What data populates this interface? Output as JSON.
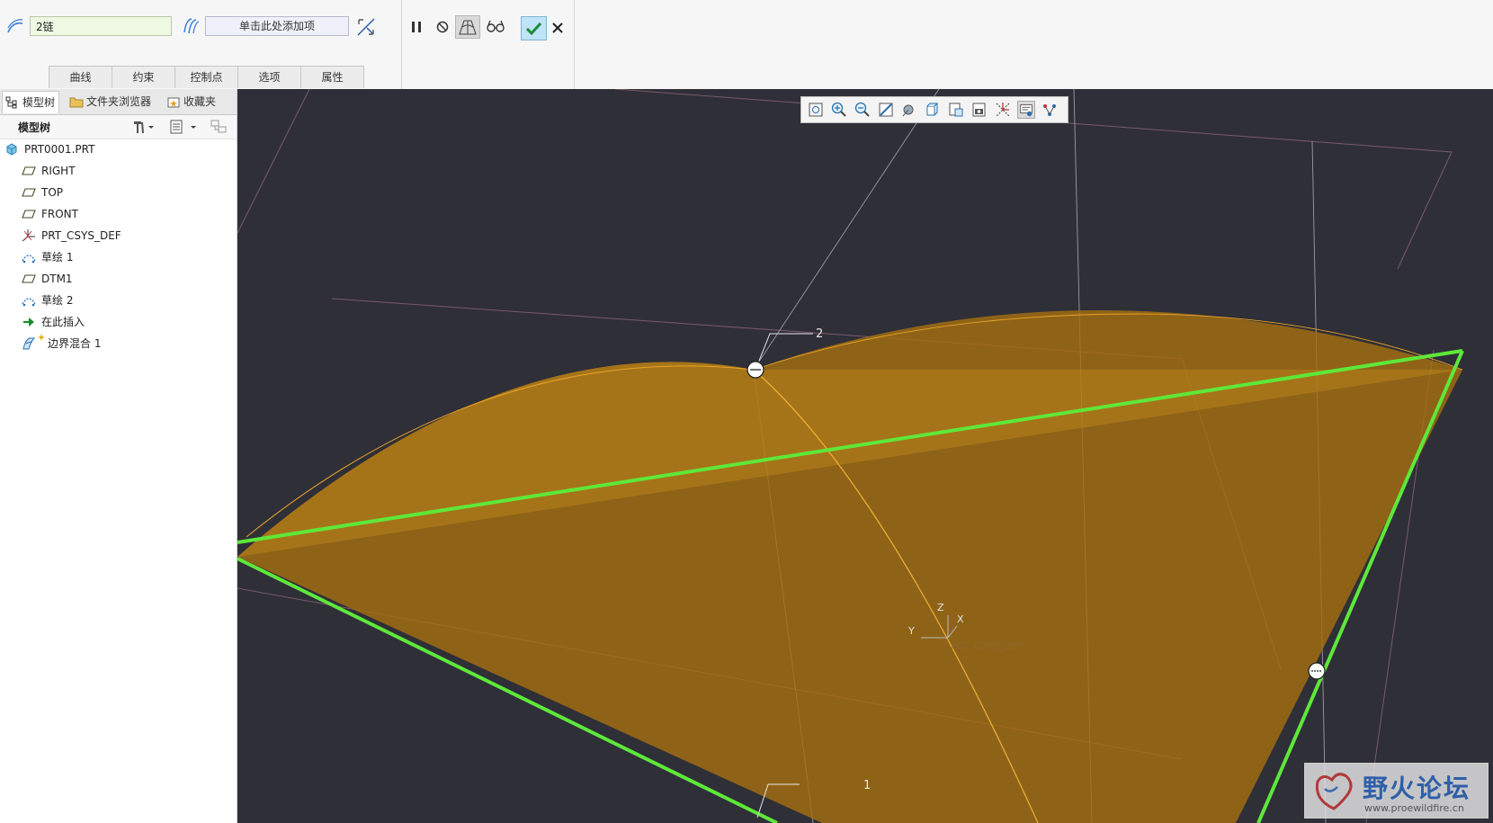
{
  "ribbon": {
    "chain_value": "2链",
    "add_item_placeholder": "单击此处添加项",
    "tabs": [
      "曲线",
      "约束",
      "控制点",
      "选项",
      "属性"
    ]
  },
  "sidebar": {
    "tabs": [
      "模型树",
      "文件夹浏览器",
      "收藏夹"
    ],
    "header_title": "模型树",
    "items": [
      {
        "label": "PRT0001.PRT",
        "icon": "part-icon"
      },
      {
        "label": "RIGHT",
        "icon": "datum-plane-icon"
      },
      {
        "label": "TOP",
        "icon": "datum-plane-icon"
      },
      {
        "label": "FRONT",
        "icon": "datum-plane-icon"
      },
      {
        "label": "PRT_CSYS_DEF",
        "icon": "csys-icon"
      },
      {
        "label": "草绘 1",
        "icon": "sketch-icon"
      },
      {
        "label": "DTM1",
        "icon": "datum-plane-icon"
      },
      {
        "label": "草绘 2",
        "icon": "sketch-icon"
      },
      {
        "label": "在此插入",
        "icon": "insert-arrow-icon"
      },
      {
        "label": "边界混合 1",
        "icon": "boundary-blend-icon"
      }
    ]
  },
  "viewport": {
    "chain_label_top": "2",
    "chain_label_bottom": "1",
    "csys_axes": [
      "Z",
      "X",
      "Y"
    ],
    "csys_label": "PRT_CSYS_DEF"
  },
  "watermark": {
    "title": "野火论坛",
    "url": "www.proewildfire.cn"
  },
  "colors": {
    "viewport_bg": "#2f2f38",
    "surface": "#b07a10",
    "chain_green": "#5ee83a",
    "ok_button": "#bfe3f7"
  }
}
